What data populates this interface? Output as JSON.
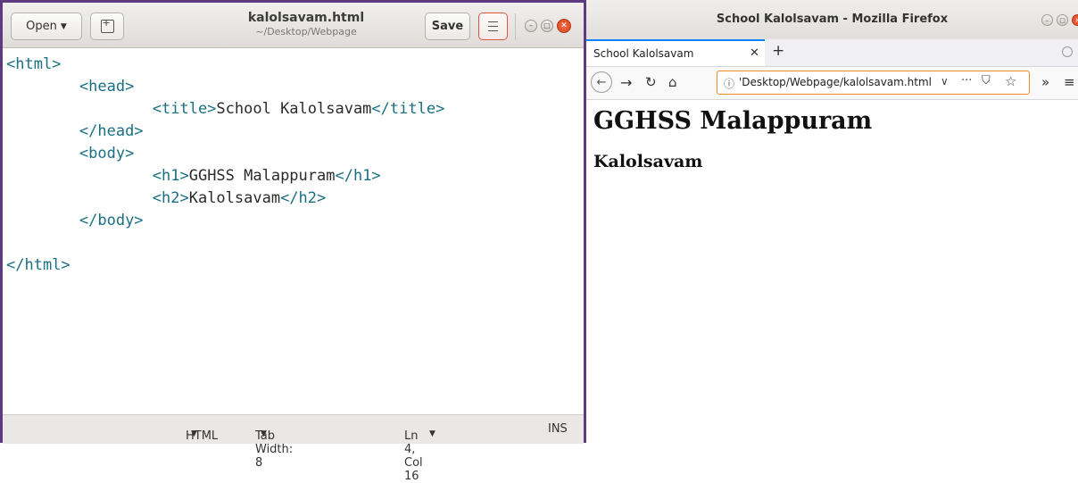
{
  "editor": {
    "open_label": "Open",
    "file_name": "kalolsavam.html",
    "file_path": "~/Desktop/Webpage",
    "save_label": "Save",
    "code_lines": [
      [
        {
          "t": "<html>",
          "c": "tag"
        }
      ],
      [
        {
          "t": "        "
        },
        {
          "t": "<head>",
          "c": "tag"
        }
      ],
      [
        {
          "t": "                "
        },
        {
          "t": "<title>",
          "c": "tag"
        },
        {
          "t": "School Kalolsavam"
        },
        {
          "t": "</title>",
          "c": "tag"
        }
      ],
      [
        {
          "t": "        "
        },
        {
          "t": "</head>",
          "c": "tag"
        }
      ],
      [
        {
          "t": "        "
        },
        {
          "t": "<body>",
          "c": "tag"
        }
      ],
      [
        {
          "t": "                "
        },
        {
          "t": "<h1>",
          "c": "tag"
        },
        {
          "t": "GGHSS Malappuram"
        },
        {
          "t": "</h1>",
          "c": "tag"
        }
      ],
      [
        {
          "t": "                "
        },
        {
          "t": "<h2>",
          "c": "tag"
        },
        {
          "t": "Kalolsavam"
        },
        {
          "t": "</h2>",
          "c": "tag"
        }
      ],
      [
        {
          "t": "        "
        },
        {
          "t": "</body>",
          "c": "tag"
        }
      ],
      [],
      [
        {
          "t": "</html>",
          "c": "tag"
        }
      ]
    ],
    "status": {
      "language": "HTML",
      "tab_width": "Tab Width: 8",
      "position": "Ln 4, Col 16",
      "mode": "INS"
    }
  },
  "browser": {
    "window_title": "School Kalolsavam - Mozilla Firefox",
    "tab_title": "School Kalolsavam",
    "url": "'Desktop/Webpage/kalolsavam.html",
    "page_h1": "GGHSS Malappuram",
    "page_h2": "Kalolsavam"
  },
  "colors": {
    "tag": "#1a6f83",
    "window_border": "#5e3a80",
    "close_button": "#e95420",
    "url_focus": "#f08a24",
    "tab_accent": "#0a84ff"
  }
}
